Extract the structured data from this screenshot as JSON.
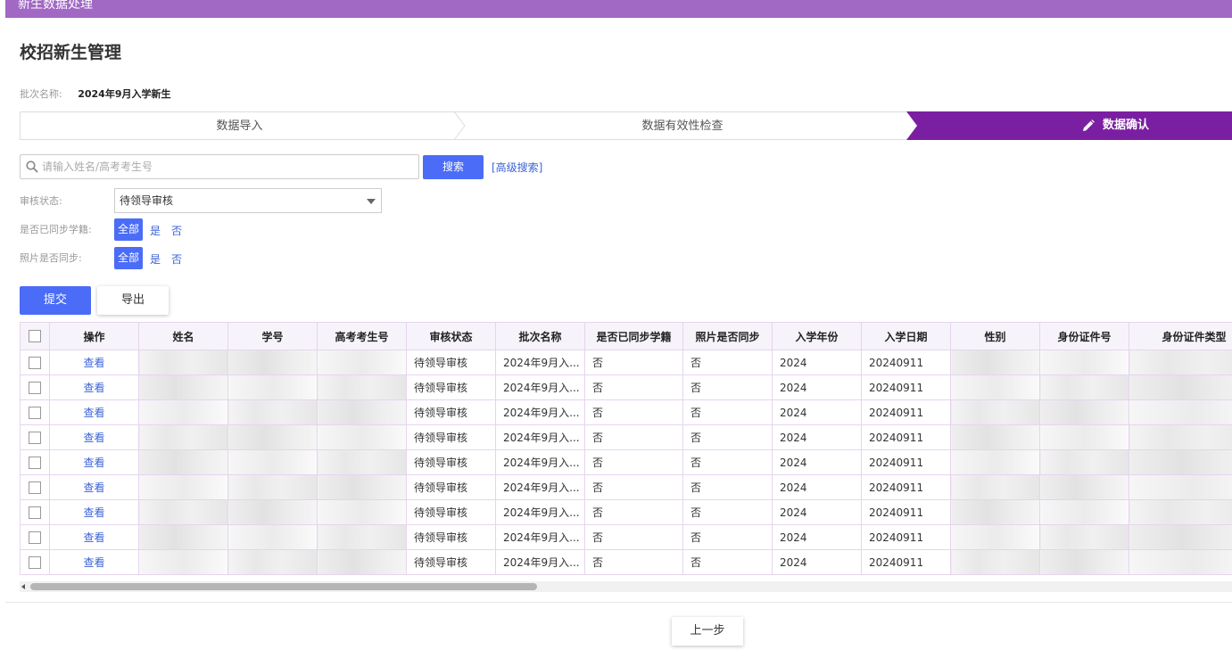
{
  "header": {
    "title": "新生数据处理"
  },
  "page": {
    "title": "校招新生管理",
    "batch_label": "批次名称:",
    "batch_value": "2024年9月入学新生"
  },
  "steps": [
    {
      "label": "数据导入",
      "active": false
    },
    {
      "label": "数据有效性检查",
      "active": false
    },
    {
      "label": "数据确认",
      "active": true
    }
  ],
  "search": {
    "placeholder": "请输入姓名/高考考生号",
    "value": "",
    "button": "搜索",
    "advanced": "[高级搜索]"
  },
  "filters": {
    "review_status": {
      "label": "审核状态:",
      "selected": "待领导审核"
    },
    "sync_roll": {
      "label": "是否已同步学籍:",
      "options": [
        "全部",
        "是",
        "否"
      ],
      "selected": "全部"
    },
    "sync_photo": {
      "label": "照片是否同步:",
      "options": [
        "全部",
        "是",
        "否"
      ],
      "selected": "全部"
    }
  },
  "actions": {
    "submit": "提交",
    "export": "导出"
  },
  "table": {
    "columns": [
      "操作",
      "姓名",
      "学号",
      "高考考生号",
      "审核状态",
      "批次名称",
      "是否已同步学籍",
      "照片是否同步",
      "入学年份",
      "入学日期",
      "性别",
      "身份证件号",
      "身份证件类型"
    ],
    "rows": [
      {
        "op": "查看",
        "status": "待领导审核",
        "batch": "2024年9月入...",
        "sync_roll": "否",
        "sync_photo": "否",
        "year": "2024",
        "date": "20240911"
      },
      {
        "op": "查看",
        "status": "待领导审核",
        "batch": "2024年9月入...",
        "sync_roll": "否",
        "sync_photo": "否",
        "year": "2024",
        "date": "20240911"
      },
      {
        "op": "查看",
        "status": "待领导审核",
        "batch": "2024年9月入...",
        "sync_roll": "否",
        "sync_photo": "否",
        "year": "2024",
        "date": "20240911"
      },
      {
        "op": "查看",
        "status": "待领导审核",
        "batch": "2024年9月入...",
        "sync_roll": "否",
        "sync_photo": "否",
        "year": "2024",
        "date": "20240911"
      },
      {
        "op": "查看",
        "status": "待领导审核",
        "batch": "2024年9月入...",
        "sync_roll": "否",
        "sync_photo": "否",
        "year": "2024",
        "date": "20240911"
      },
      {
        "op": "查看",
        "status": "待领导审核",
        "batch": "2024年9月入...",
        "sync_roll": "否",
        "sync_photo": "否",
        "year": "2024",
        "date": "20240911"
      },
      {
        "op": "查看",
        "status": "待领导审核",
        "batch": "2024年9月入...",
        "sync_roll": "否",
        "sync_photo": "否",
        "year": "2024",
        "date": "20240911"
      },
      {
        "op": "查看",
        "status": "待领导审核",
        "batch": "2024年9月入...",
        "sync_roll": "否",
        "sync_photo": "否",
        "year": "2024",
        "date": "20240911"
      },
      {
        "op": "查看",
        "status": "待领导审核",
        "batch": "2024年9月入...",
        "sync_roll": "否",
        "sync_photo": "否",
        "year": "2024",
        "date": "20240911"
      }
    ]
  },
  "footer": {
    "prev": "上一步"
  },
  "colors": {
    "header_bg": "#a168c4",
    "active_step": "#7b1fa2",
    "primary": "#4a6cf7",
    "link": "#3b63d9"
  }
}
